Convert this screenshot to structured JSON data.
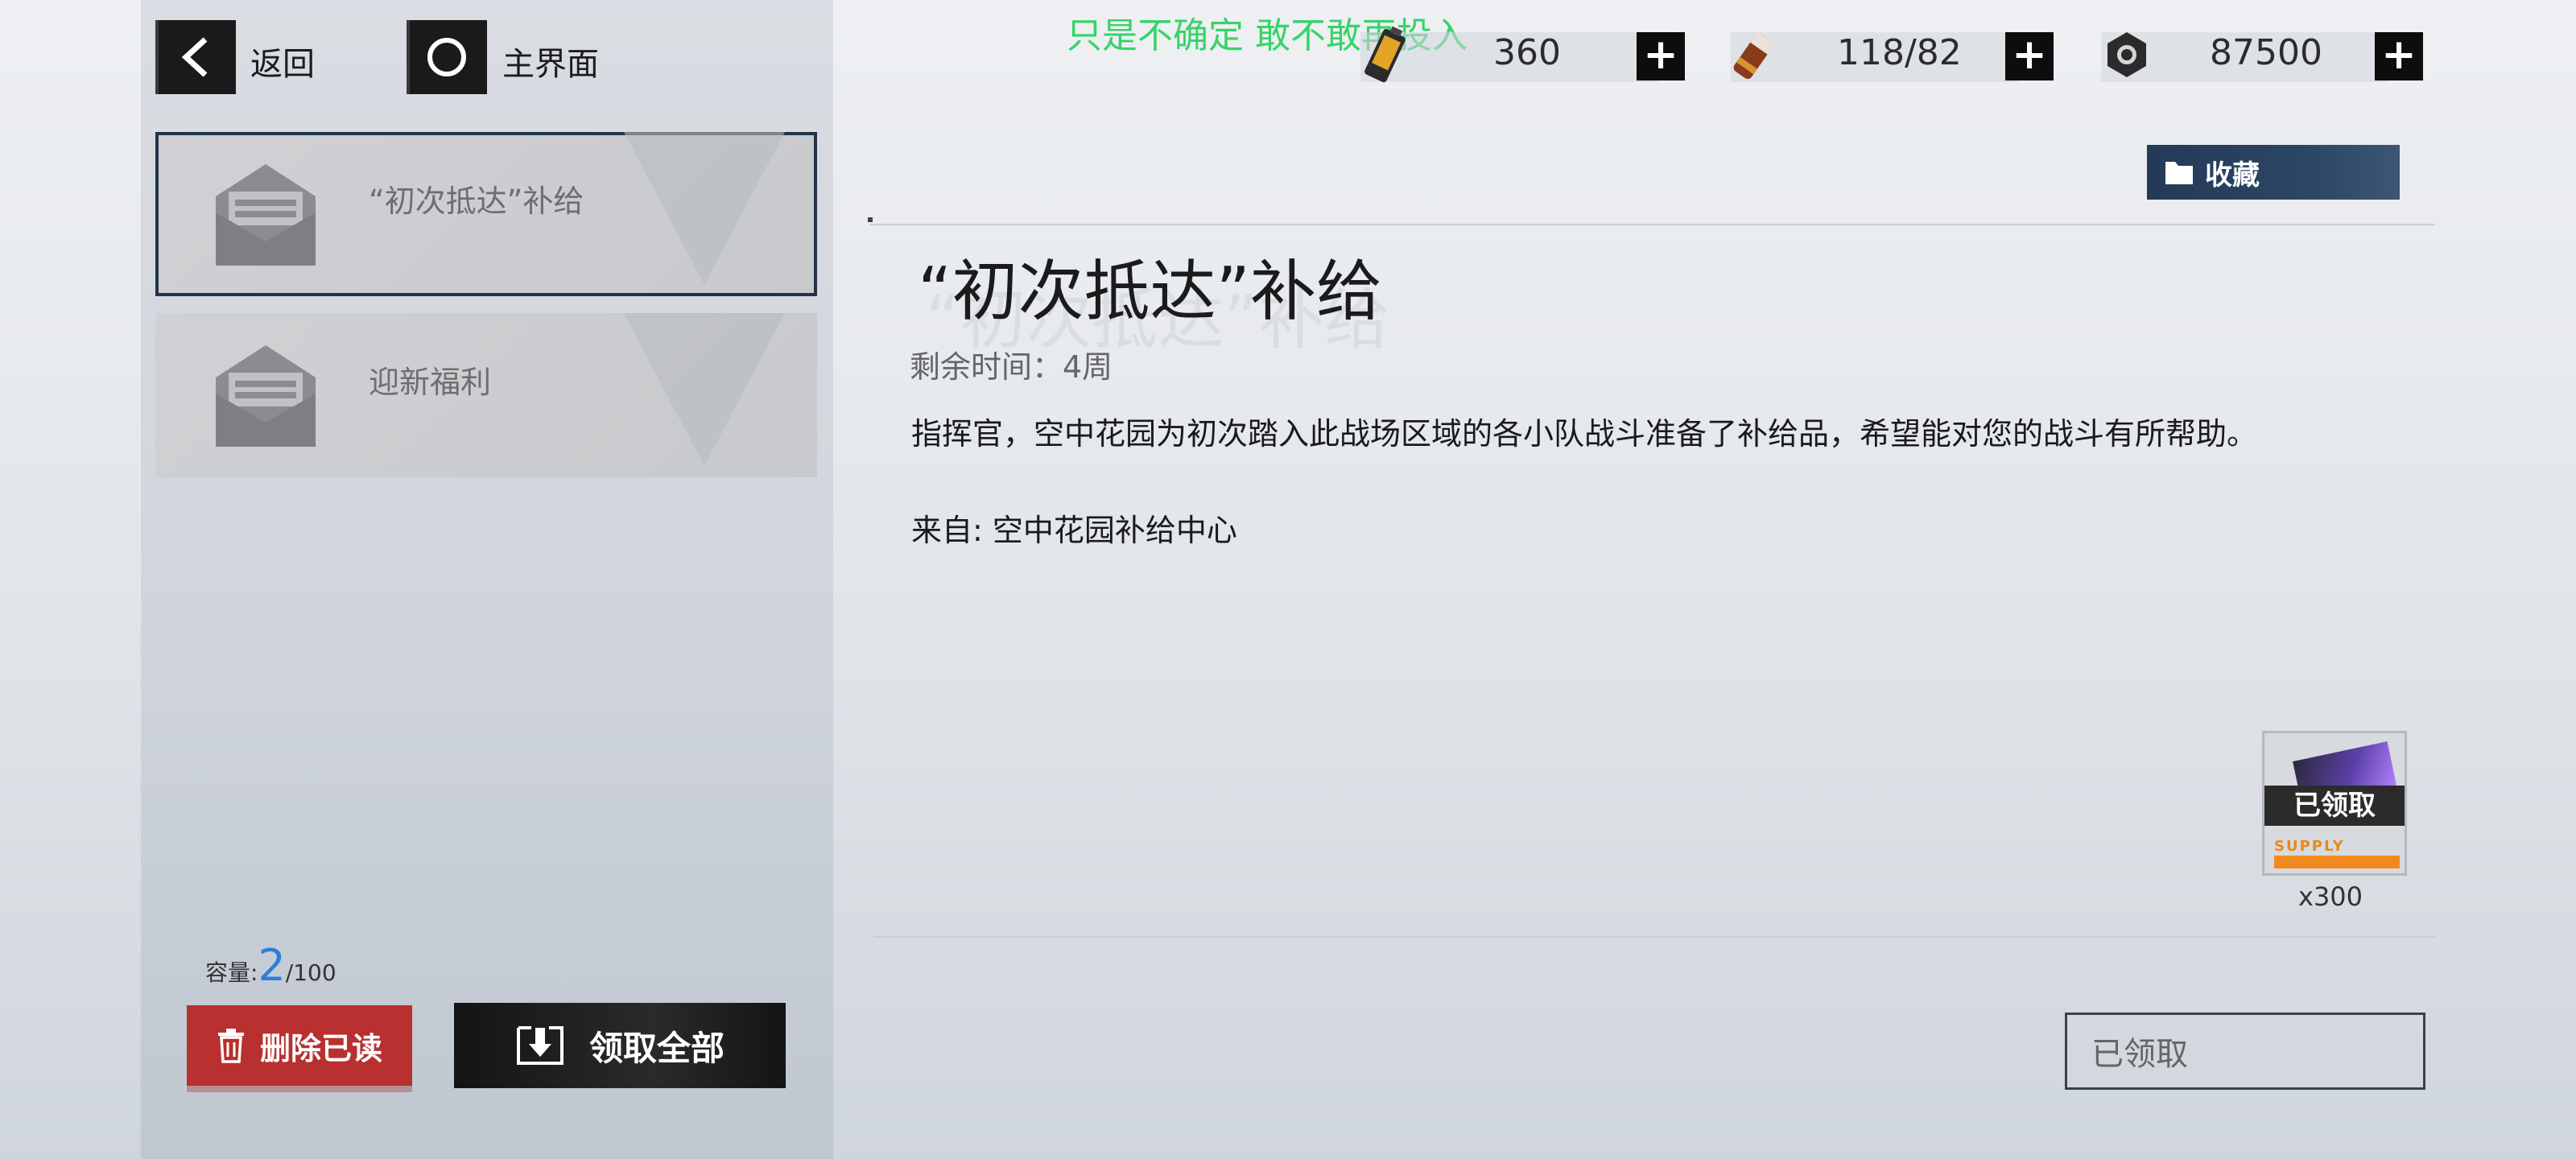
{
  "nav": {
    "back_label": "返回",
    "home_label": "主界面"
  },
  "overlay": {
    "text": "只是不确定 敢不敢再投入"
  },
  "resources": [
    {
      "icon": "battery-icon",
      "value": "360"
    },
    {
      "icon": "ammo-icon",
      "value": "118/82"
    },
    {
      "icon": "gear-nut-icon",
      "value": "87500"
    }
  ],
  "mail_list": [
    {
      "title": "“初次抵达”补给",
      "selected": true
    },
    {
      "title": "迎新福利",
      "selected": false
    }
  ],
  "capacity": {
    "label": "容量:",
    "current": "2",
    "max": "/100"
  },
  "actions": {
    "delete_read": "删除已读",
    "claim_all": "领取全部"
  },
  "detail": {
    "favorite_label": "收藏",
    "title": "“初次抵达”补给",
    "remaining": "剩余时间：4周",
    "body": "指挥官，空中花园为初次踏入此战场区域的各小队战斗准备了补给品，希望能对您的战斗有所帮助。",
    "from": "来自: 空中花园补给中心",
    "attachment": {
      "status": "已领取",
      "supply_text": "SUPPLY",
      "quantity": "x300"
    },
    "claim_button": "已领取"
  },
  "colors": {
    "accent_dark": "#22324a",
    "delete_red": "#b8302f",
    "capacity_blue": "#2d7fd6",
    "overlay_green": "#37d36a"
  }
}
